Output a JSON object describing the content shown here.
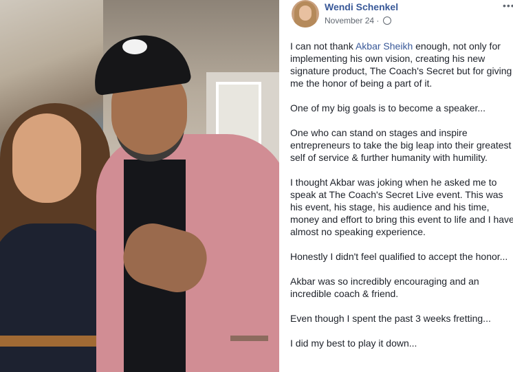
{
  "post": {
    "author": "Wendi Schenkel",
    "date": "November 24",
    "meta_separator": "·",
    "more_glyph": "•••",
    "privacy_icon": "globe-icon",
    "paragraphs": {
      "p1": {
        "before": "I can not thank ",
        "mention": "Akbar Sheikh",
        "after": " enough, not only for",
        "l2": "implementing his own vision, creating his new",
        "l3": "signature product, The Coach's Secret but for giving",
        "l4": "me the honor of being a part of it."
      },
      "p2": "One of my big goals is to become a speaker...",
      "p3": {
        "l1": "One who can stand on stages and inspire",
        "l2": "entrepreneurs to take the big leap into their greatest",
        "l3": "self of service & further humanity with humility."
      },
      "p4": {
        "l1": "I thought Akbar was joking when he asked me to",
        "l2": "speak at The Coach's Secret Live event. This was",
        "l3": "his event, his stage, his audience and his time,",
        "l4": "money and effort to bring this event to life and I have",
        "l5": "almost no speaking experience."
      },
      "p5": "Honestly I didn't feel qualified to accept the honor...",
      "p6": {
        "l1": "Akbar was so incredibly encouraging and an",
        "l2": "incredible coach & friend."
      },
      "p7": "Even though I spent the past 3 weeks fretting...",
      "p8": "I did my best to play it down..."
    }
  },
  "colors": {
    "link": "#385898",
    "text": "#1d2129",
    "meta": "#606770"
  }
}
